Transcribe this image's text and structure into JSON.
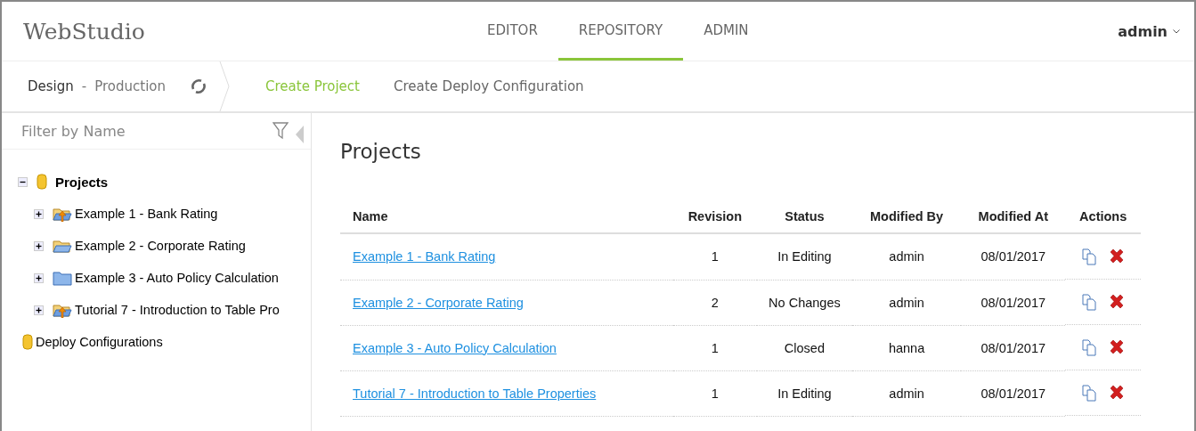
{
  "app": {
    "title": "WebStudio"
  },
  "tabs": [
    {
      "label": "EDITOR",
      "selected": false
    },
    {
      "label": "REPOSITORY",
      "selected": true
    },
    {
      "label": "ADMIN",
      "selected": false
    }
  ],
  "user_menu": {
    "label": "admin"
  },
  "toolbar": {
    "branch": {
      "current": "Design",
      "separator": "-",
      "other": "Production"
    },
    "actions": [
      {
        "label": "Create Project",
        "selected": true
      },
      {
        "label": "Create Deploy Configuration",
        "selected": false
      }
    ]
  },
  "sidebar": {
    "filter": {
      "placeholder": "Filter by Name"
    },
    "tree": [
      {
        "label": "Projects",
        "kind": "repo",
        "expanded": true,
        "children": [
          {
            "label": "Example 1 - Bank Rating",
            "kind": "folder-arrow",
            "expanded": false
          },
          {
            "label": "Example 2 - Corporate Rating",
            "kind": "folder-open",
            "expanded": false
          },
          {
            "label": "Example 3 - Auto Policy Calculation",
            "kind": "folder-closed",
            "expanded": false
          },
          {
            "label": "Tutorial 7 - Introduction to Table Pro",
            "kind": "folder-arrow",
            "expanded": false
          }
        ]
      },
      {
        "label": "Deploy Configurations",
        "kind": "repo"
      }
    ]
  },
  "main": {
    "title": "Projects",
    "table": {
      "columns": [
        "Name",
        "Revision",
        "Status",
        "Modified By",
        "Modified At",
        "Actions"
      ],
      "rows": [
        {
          "name": "Example 1 - Bank Rating",
          "revision": "1",
          "status": "In Editing",
          "modified_by": "admin",
          "modified_at": "08/01/2017"
        },
        {
          "name": "Example 2 - Corporate Rating",
          "revision": "2",
          "status": "No Changes",
          "modified_by": "admin",
          "modified_at": "08/01/2017"
        },
        {
          "name": "Example 3 - Auto Policy Calculation",
          "revision": "1",
          "status": "Closed",
          "modified_by": "hanna",
          "modified_at": "08/01/2017"
        },
        {
          "name": "Tutorial 7 - Introduction to Table Properties",
          "revision": "1",
          "status": "In Editing",
          "modified_by": "admin",
          "modified_at": "08/01/2017"
        }
      ]
    }
  }
}
